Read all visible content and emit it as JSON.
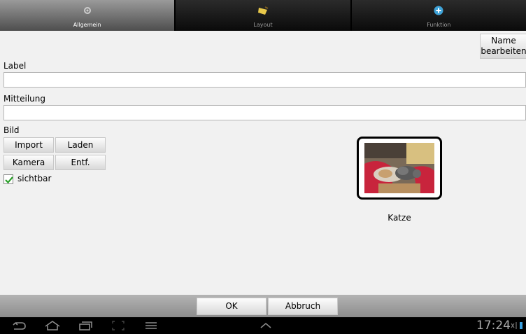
{
  "tabs": [
    {
      "label": "Allgemein",
      "icon": "settings-icon",
      "active": true
    },
    {
      "label": "Layout",
      "icon": "paint-icon",
      "active": false
    },
    {
      "label": "Funktion",
      "icon": "plus-circle-icon",
      "active": false
    }
  ],
  "form": {
    "name_button": {
      "line1": "Name",
      "line2": "bearbeiten"
    },
    "label_title": "Label",
    "label_value": "",
    "message_title": "Mitteilung",
    "message_value": "",
    "image_title": "Bild",
    "buttons": {
      "import": "Import",
      "load": "Laden",
      "camera": "Kamera",
      "remove": "Entf."
    },
    "visible_label": "sichtbar",
    "visible_checked": true,
    "image_caption": "Katze"
  },
  "dialog": {
    "ok": "OK",
    "cancel": "Abbruch"
  },
  "system": {
    "time": "17:24"
  }
}
